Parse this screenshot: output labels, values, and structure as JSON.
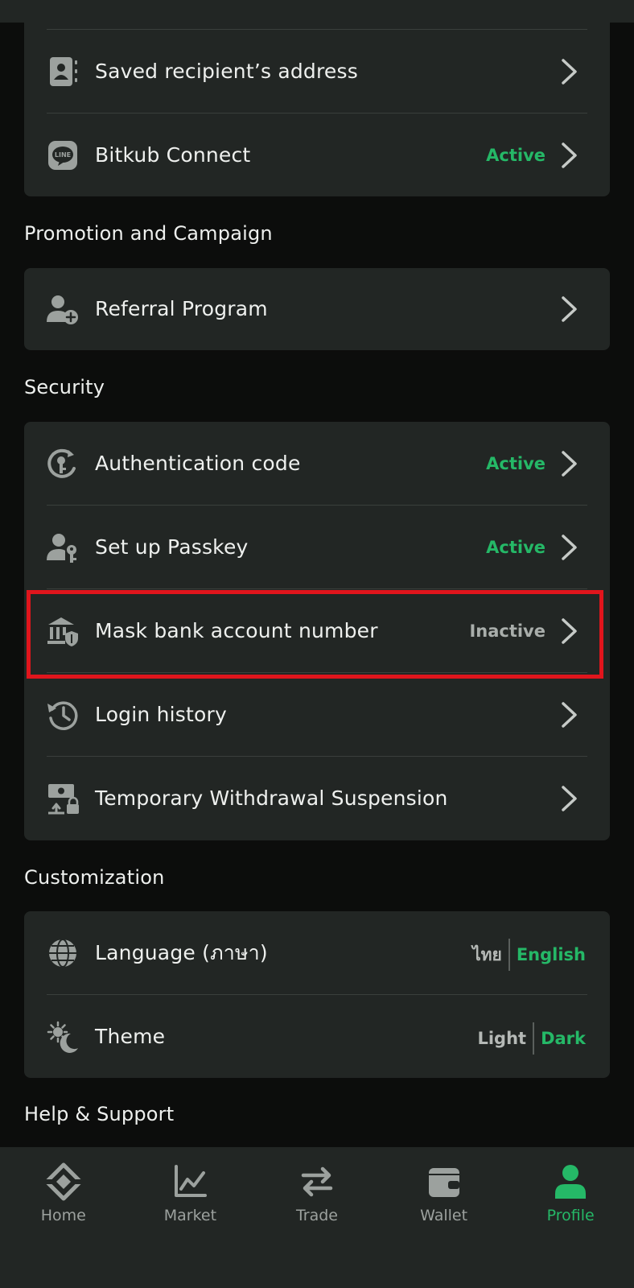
{
  "colors": {
    "background": "#0c0d0c",
    "card": "#222624",
    "accent_green": "#25b867",
    "highlight_red": "#e0151c",
    "text_primary": "#eef0ee",
    "text_muted": "#9ca19e"
  },
  "card_top": {
    "items": [
      {
        "label": "Saved recipient’s address",
        "icon": "contact-book-icon"
      },
      {
        "label": "Bitkub Connect",
        "status": "Active",
        "icon": "line-app-icon"
      }
    ]
  },
  "promotion": {
    "title": "Promotion and Campaign",
    "items": [
      {
        "label": "Referral Program",
        "icon": "add-user-icon"
      }
    ]
  },
  "security": {
    "title": "Security",
    "items": [
      {
        "label": "Authentication code",
        "status": "Active",
        "icon": "authentication-key-icon"
      },
      {
        "label": "Set up Passkey",
        "status": "Active",
        "icon": "passkey-user-icon"
      },
      {
        "label": "Mask bank account number",
        "status": "Inactive",
        "icon": "bank-shield-icon"
      },
      {
        "label": "Login history",
        "icon": "history-clock-icon"
      },
      {
        "label": "Temporary Withdrawal Suspension",
        "icon": "money-lock-icon"
      }
    ]
  },
  "customization": {
    "title": "Customization",
    "language": {
      "label": "Language (ภาษา)",
      "icon": "globe-icon",
      "options": [
        "ไทย",
        "English"
      ],
      "selected": "English"
    },
    "theme": {
      "label": "Theme",
      "icon": "sun-moon-icon",
      "options": [
        "Light",
        "Dark"
      ],
      "selected": "Dark"
    }
  },
  "help": {
    "title": "Help & Support"
  },
  "bottom_nav": {
    "items": [
      {
        "label": "Home",
        "icon": "bitkub-logo-icon"
      },
      {
        "label": "Market",
        "icon": "chart-line-icon"
      },
      {
        "label": "Trade",
        "icon": "swap-arrows-icon"
      },
      {
        "label": "Wallet",
        "icon": "wallet-icon"
      },
      {
        "label": "Profile",
        "icon": "profile-user-icon"
      }
    ],
    "active": "Profile"
  }
}
